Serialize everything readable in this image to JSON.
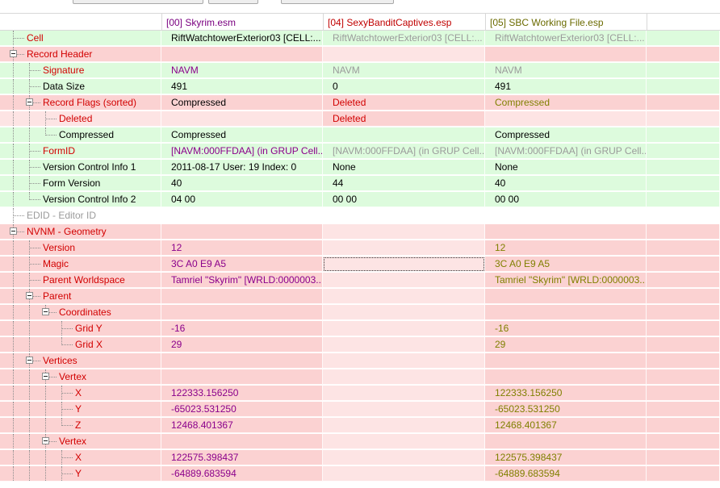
{
  "colors": {
    "green_bg": "#ddfbdd",
    "red_bg": "#fbd2d2",
    "pink_bg": "#fde4e4",
    "gray_text": "#9b9b9b",
    "purple_text": "#8b008b",
    "red_text": "#d20000",
    "olive_text": "#808000",
    "black_text": "#000000",
    "header_purple": "#7a0080",
    "header_red": "#c00000",
    "header_olive": "#6b6b00"
  },
  "columns": [
    {
      "label": "",
      "color": "#000000"
    },
    {
      "label": "[00] Skyrim.esm",
      "color": "#7a0080"
    },
    {
      "label": "[04] SexyBanditCaptives.esp",
      "color": "#c00000"
    },
    {
      "label": "[05] SBC Working File.esp",
      "color": "#6b6b00"
    }
  ],
  "rows": [
    {
      "name": "Cell",
      "depth": 0,
      "expander": false,
      "nameColor": "#d20000",
      "bg": [
        "#ddfbdd",
        "#ddfbdd",
        "#ddfbdd",
        "#ddfbdd",
        "#ddfbdd"
      ],
      "values": [
        {
          "t": "RiftWatchtowerExterior03 [CELL:...",
          "c": "#000000"
        },
        {
          "t": "RiftWatchtowerExterior03 [CELL:...",
          "c": "#9b9b9b"
        },
        {
          "t": "RiftWatchtowerExterior03 [CELL:...",
          "c": "#9b9b9b"
        }
      ]
    },
    {
      "name": "Record Header",
      "depth": 0,
      "expander": true,
      "nameColor": "#d20000",
      "bg": [
        "#fbd2d2",
        "#fbd2d2",
        "#fde4e4",
        "#fbd2d2",
        "#fbd2d2"
      ],
      "values": [
        {
          "t": "",
          "c": "#000000"
        },
        {
          "t": "",
          "c": "#000000"
        },
        {
          "t": "",
          "c": "#000000"
        }
      ]
    },
    {
      "name": "Signature",
      "depth": 1,
      "expander": false,
      "nameColor": "#d20000",
      "bg": [
        "#ddfbdd",
        "#ddfbdd",
        "#ddfbdd",
        "#ddfbdd",
        "#ddfbdd"
      ],
      "values": [
        {
          "t": "NAVM",
          "c": "#8b008b"
        },
        {
          "t": "NAVM",
          "c": "#9b9b9b"
        },
        {
          "t": "NAVM",
          "c": "#9b9b9b"
        }
      ]
    },
    {
      "name": "Data Size",
      "depth": 1,
      "expander": false,
      "nameColor": "#000000",
      "bg": [
        "#ddfbdd",
        "#ddfbdd",
        "#ddfbdd",
        "#ddfbdd",
        "#ddfbdd"
      ],
      "values": [
        {
          "t": "491",
          "c": "#000000"
        },
        {
          "t": "0",
          "c": "#000000"
        },
        {
          "t": "491",
          "c": "#000000"
        }
      ]
    },
    {
      "name": "Record Flags (sorted)",
      "depth": 1,
      "expander": true,
      "nameColor": "#d20000",
      "bg": [
        "#fbd2d2",
        "#fbd2d2",
        "#fbd2d2",
        "#fbd2d2",
        "#fbd2d2"
      ],
      "values": [
        {
          "t": "Compressed",
          "c": "#000000"
        },
        {
          "t": "Deleted",
          "c": "#d20000"
        },
        {
          "t": "Compressed",
          "c": "#808000"
        }
      ]
    },
    {
      "name": "Deleted",
      "depth": 2,
      "expander": false,
      "nameColor": "#d20000",
      "bg": [
        "#fde4e4",
        "#fde4e4",
        "#fbd2d2",
        "#fde4e4",
        "#fde4e4"
      ],
      "values": [
        {
          "t": "",
          "c": "#000000"
        },
        {
          "t": "Deleted",
          "c": "#d20000"
        },
        {
          "t": "",
          "c": "#000000"
        }
      ]
    },
    {
      "name": "Compressed",
      "depth": 2,
      "expander": false,
      "nameColor": "#000000",
      "bg": [
        "#ddfbdd",
        "#ddfbdd",
        "#ddfbdd",
        "#ddfbdd",
        "#ddfbdd"
      ],
      "values": [
        {
          "t": "Compressed",
          "c": "#000000"
        },
        {
          "t": "",
          "c": "#000000"
        },
        {
          "t": "Compressed",
          "c": "#000000"
        }
      ]
    },
    {
      "name": "FormID",
      "depth": 1,
      "expander": false,
      "nameColor": "#d20000",
      "bg": [
        "#ddfbdd",
        "#ddfbdd",
        "#ddfbdd",
        "#ddfbdd",
        "#ddfbdd"
      ],
      "values": [
        {
          "t": "[NAVM:000FFDAA] (in GRUP Cell...",
          "c": "#8b008b"
        },
        {
          "t": "[NAVM:000FFDAA] (in GRUP Cell...",
          "c": "#9b9b9b"
        },
        {
          "t": "[NAVM:000FFDAA] (in GRUP Cell...",
          "c": "#9b9b9b"
        }
      ]
    },
    {
      "name": "Version Control Info 1",
      "depth": 1,
      "expander": false,
      "nameColor": "#000000",
      "bg": [
        "#ddfbdd",
        "#ddfbdd",
        "#ddfbdd",
        "#ddfbdd",
        "#ddfbdd"
      ],
      "values": [
        {
          "t": "2011-08-17 User: 19 Index: 0",
          "c": "#000000"
        },
        {
          "t": "None",
          "c": "#000000"
        },
        {
          "t": "None",
          "c": "#000000"
        }
      ]
    },
    {
      "name": "Form Version",
      "depth": 1,
      "expander": false,
      "nameColor": "#000000",
      "bg": [
        "#ddfbdd",
        "#ddfbdd",
        "#ddfbdd",
        "#ddfbdd",
        "#ddfbdd"
      ],
      "values": [
        {
          "t": "40",
          "c": "#000000"
        },
        {
          "t": "44",
          "c": "#000000"
        },
        {
          "t": "40",
          "c": "#000000"
        }
      ]
    },
    {
      "name": "Version Control Info 2",
      "depth": 1,
      "expander": false,
      "nameColor": "#000000",
      "bg": [
        "#ddfbdd",
        "#ddfbdd",
        "#ddfbdd",
        "#ddfbdd",
        "#ddfbdd"
      ],
      "values": [
        {
          "t": "04 00",
          "c": "#000000"
        },
        {
          "t": "00 00",
          "c": "#000000"
        },
        {
          "t": "00 00",
          "c": "#000000"
        }
      ]
    },
    {
      "name": "EDID - Editor ID",
      "depth": 0,
      "expander": false,
      "nameColor": "#9b9b9b",
      "bg": [
        "#ffffff",
        "#ffffff",
        "#ffffff",
        "#ffffff",
        "#ffffff"
      ],
      "values": [
        {
          "t": "",
          "c": "#000000"
        },
        {
          "t": "",
          "c": "#000000"
        },
        {
          "t": "",
          "c": "#000000"
        }
      ]
    },
    {
      "name": "NVNM - Geometry",
      "depth": 0,
      "expander": true,
      "nameColor": "#d20000",
      "bg": [
        "#fbd2d2",
        "#fbd2d2",
        "#fde4e4",
        "#fbd2d2",
        "#fbd2d2"
      ],
      "values": [
        {
          "t": "",
          "c": "#000000"
        },
        {
          "t": "",
          "c": "#000000"
        },
        {
          "t": "",
          "c": "#000000"
        }
      ]
    },
    {
      "name": "Version",
      "depth": 1,
      "expander": false,
      "nameColor": "#d20000",
      "bg": [
        "#fbd2d2",
        "#fbd2d2",
        "#fde4e4",
        "#fbd2d2",
        "#fbd2d2"
      ],
      "values": [
        {
          "t": "12",
          "c": "#8b008b"
        },
        {
          "t": "",
          "c": "#000000"
        },
        {
          "t": "12",
          "c": "#808000"
        }
      ]
    },
    {
      "name": "Magic",
      "depth": 1,
      "expander": false,
      "nameColor": "#d20000",
      "bg": [
        "#fbd2d2",
        "#fbd2d2",
        "#fde4e4",
        "#fbd2d2",
        "#fbd2d2"
      ],
      "focus": 1,
      "values": [
        {
          "t": "3C A0 E9 A5",
          "c": "#8b008b"
        },
        {
          "t": "",
          "c": "#000000"
        },
        {
          "t": "3C A0 E9 A5",
          "c": "#808000"
        }
      ]
    },
    {
      "name": "Parent Worldspace",
      "depth": 1,
      "expander": false,
      "nameColor": "#d20000",
      "bg": [
        "#fbd2d2",
        "#fbd2d2",
        "#fde4e4",
        "#fbd2d2",
        "#fbd2d2"
      ],
      "values": [
        {
          "t": "Tamriel \"Skyrim\" [WRLD:0000003...",
          "c": "#8b008b"
        },
        {
          "t": "",
          "c": "#000000"
        },
        {
          "t": "Tamriel \"Skyrim\" [WRLD:0000003...",
          "c": "#808000"
        }
      ]
    },
    {
      "name": "Parent",
      "depth": 1,
      "expander": true,
      "nameColor": "#d20000",
      "bg": [
        "#fbd2d2",
        "#fbd2d2",
        "#fde4e4",
        "#fbd2d2",
        "#fbd2d2"
      ],
      "values": [
        {
          "t": "",
          "c": "#000000"
        },
        {
          "t": "",
          "c": "#000000"
        },
        {
          "t": "",
          "c": "#000000"
        }
      ]
    },
    {
      "name": "Coordinates",
      "depth": 2,
      "expander": true,
      "nameColor": "#d20000",
      "bg": [
        "#fbd2d2",
        "#fbd2d2",
        "#fde4e4",
        "#fbd2d2",
        "#fbd2d2"
      ],
      "values": [
        {
          "t": "",
          "c": "#000000"
        },
        {
          "t": "",
          "c": "#000000"
        },
        {
          "t": "",
          "c": "#000000"
        }
      ]
    },
    {
      "name": "Grid Y",
      "depth": 3,
      "expander": false,
      "nameColor": "#d20000",
      "bg": [
        "#fbd2d2",
        "#fbd2d2",
        "#fde4e4",
        "#fbd2d2",
        "#fbd2d2"
      ],
      "values": [
        {
          "t": "-16",
          "c": "#8b008b"
        },
        {
          "t": "",
          "c": "#000000"
        },
        {
          "t": "-16",
          "c": "#808000"
        }
      ]
    },
    {
      "name": "Grid X",
      "depth": 3,
      "expander": false,
      "nameColor": "#d20000",
      "bg": [
        "#fbd2d2",
        "#fbd2d2",
        "#fde4e4",
        "#fbd2d2",
        "#fbd2d2"
      ],
      "values": [
        {
          "t": "29",
          "c": "#8b008b"
        },
        {
          "t": "",
          "c": "#000000"
        },
        {
          "t": "29",
          "c": "#808000"
        }
      ]
    },
    {
      "name": "Vertices",
      "depth": 1,
      "expander": true,
      "nameColor": "#d20000",
      "bg": [
        "#fbd2d2",
        "#fbd2d2",
        "#fde4e4",
        "#fbd2d2",
        "#fbd2d2"
      ],
      "values": [
        {
          "t": "",
          "c": "#000000"
        },
        {
          "t": "",
          "c": "#000000"
        },
        {
          "t": "",
          "c": "#000000"
        }
      ]
    },
    {
      "name": "Vertex",
      "depth": 2,
      "expander": true,
      "nameColor": "#d20000",
      "bg": [
        "#fbd2d2",
        "#fbd2d2",
        "#fde4e4",
        "#fbd2d2",
        "#fbd2d2"
      ],
      "values": [
        {
          "t": "",
          "c": "#000000"
        },
        {
          "t": "",
          "c": "#000000"
        },
        {
          "t": "",
          "c": "#000000"
        }
      ]
    },
    {
      "name": "X",
      "depth": 3,
      "expander": false,
      "nameColor": "#d20000",
      "bg": [
        "#fbd2d2",
        "#fbd2d2",
        "#fde4e4",
        "#fbd2d2",
        "#fbd2d2"
      ],
      "values": [
        {
          "t": "122333.156250",
          "c": "#8b008b"
        },
        {
          "t": "",
          "c": "#000000"
        },
        {
          "t": "122333.156250",
          "c": "#808000"
        }
      ]
    },
    {
      "name": "Y",
      "depth": 3,
      "expander": false,
      "nameColor": "#d20000",
      "bg": [
        "#fbd2d2",
        "#fbd2d2",
        "#fde4e4",
        "#fbd2d2",
        "#fbd2d2"
      ],
      "values": [
        {
          "t": "-65023.531250",
          "c": "#8b008b"
        },
        {
          "t": "",
          "c": "#000000"
        },
        {
          "t": "-65023.531250",
          "c": "#808000"
        }
      ]
    },
    {
      "name": "Z",
      "depth": 3,
      "expander": false,
      "nameColor": "#d20000",
      "bg": [
        "#fbd2d2",
        "#fbd2d2",
        "#fde4e4",
        "#fbd2d2",
        "#fbd2d2"
      ],
      "values": [
        {
          "t": "12468.401367",
          "c": "#8b008b"
        },
        {
          "t": "",
          "c": "#000000"
        },
        {
          "t": "12468.401367",
          "c": "#808000"
        }
      ]
    },
    {
      "name": "Vertex",
      "depth": 2,
      "expander": true,
      "nameColor": "#d20000",
      "bg": [
        "#fbd2d2",
        "#fbd2d2",
        "#fde4e4",
        "#fbd2d2",
        "#fbd2d2"
      ],
      "values": [
        {
          "t": "",
          "c": "#000000"
        },
        {
          "t": "",
          "c": "#000000"
        },
        {
          "t": "",
          "c": "#000000"
        }
      ]
    },
    {
      "name": "X",
      "depth": 3,
      "expander": false,
      "nameColor": "#d20000",
      "bg": [
        "#fbd2d2",
        "#fbd2d2",
        "#fde4e4",
        "#fbd2d2",
        "#fbd2d2"
      ],
      "values": [
        {
          "t": "122575.398437",
          "c": "#8b008b"
        },
        {
          "t": "",
          "c": "#000000"
        },
        {
          "t": "122575.398437",
          "c": "#808000"
        }
      ]
    },
    {
      "name": "Y",
      "depth": 3,
      "expander": false,
      "nameColor": "#d20000",
      "bg": [
        "#fbd2d2",
        "#fbd2d2",
        "#fde4e4",
        "#fbd2d2",
        "#fbd2d2"
      ],
      "values": [
        {
          "t": "-64889.683594",
          "c": "#8b008b"
        },
        {
          "t": "",
          "c": "#000000"
        },
        {
          "t": "-64889.683594",
          "c": "#808000"
        }
      ]
    }
  ]
}
